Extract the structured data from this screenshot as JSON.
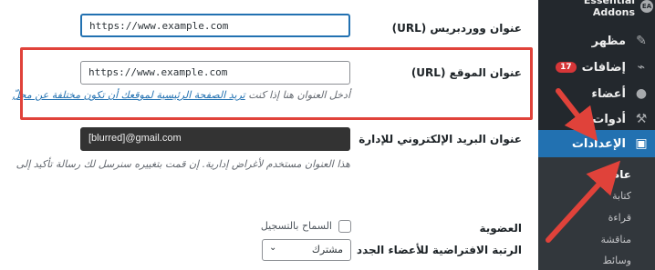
{
  "sidebar": {
    "brand": "Essential Addons",
    "brand_icon": "EA",
    "items": [
      {
        "label": "مظهر",
        "icon": "paintbrush-icon"
      },
      {
        "label": "إضافات",
        "icon": "plugin-icon",
        "badge": "17"
      },
      {
        "label": "أعضاء",
        "icon": "user-icon"
      },
      {
        "label": "أدوات",
        "icon": "wrench-icon"
      },
      {
        "label": "الإعدادات",
        "icon": "settings-icon"
      }
    ],
    "submenu": [
      "عام",
      "كتابة",
      "قراءة",
      "مناقشة",
      "وسائط"
    ]
  },
  "form": {
    "wp_url": {
      "label": "عنوان ووردبريس (URL)",
      "value": "https://www.example.com"
    },
    "site_url": {
      "label": "عنوان الموقع (URL)",
      "value": "https://www.example.com",
      "desc_prefix": "أدخل العنوان هنا إذا كنت",
      "desc_link": "تريد الصفحة الرئيسية لموقعك أن تكون مختلفة عن مجلّ"
    },
    "admin_email": {
      "label": "عنوان البريد الإلكتروني للإدارة",
      "value": "[blurred]@gmail.com",
      "desc": "هذا العنوان مستخدم لأغراض إدارية. إن قمت بتغييره سنرسل لك رسالة تأكيد إلى"
    },
    "membership": {
      "label": "العضوية",
      "checkbox_label": "السماح بالتسجيل"
    },
    "default_role": {
      "label": "الرتبة الافتراضية للأعضاء الجدد",
      "value": "مشترك"
    }
  },
  "colors": {
    "sidebar_bg": "#23282d",
    "accent": "#2271b1",
    "annotation": "#e0423a"
  }
}
